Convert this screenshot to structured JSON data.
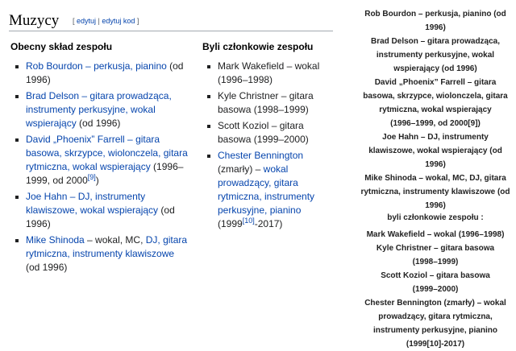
{
  "section": {
    "title": "Muzycy",
    "edit_open": "[ ",
    "edit_label": "edytuj",
    "edit_sep": " | ",
    "edit_code_label": "edytuj kod",
    "edit_close": " ]"
  },
  "current": {
    "heading": "Obecny skład zespołu",
    "members": [
      {
        "name": "Rob Bourdon",
        "sep": " – ",
        "roles": "perkusja, pianino",
        "tail": " (od 1996)"
      },
      {
        "name": "Brad Delson",
        "sep": " – ",
        "roles": "gitara prowadząca, instrumenty perkusyjne, wokal wspierający",
        "tail": " (od 1996)"
      },
      {
        "name": "David „Phoenix” Farrell",
        "sep": " – ",
        "roles": "gitara basowa, skrzypce, wiolonczela, gitara rytmiczna, wokal wspierający",
        "tail": " (1996–1999, od 2000",
        "ref": "[9]",
        "tail2": ")"
      },
      {
        "name": "Joe Hahn",
        "sep": " – ",
        "roles": "DJ, instrumenty klawiszowe, wokal wspierający",
        "tail": " (od 1996)"
      },
      {
        "name": "Mike Shinoda",
        "sep": " – wokal, MC, ",
        "roles": "DJ, gitara rytmiczna, instrumenty klawiszowe",
        "tail": " (od 1996)"
      }
    ]
  },
  "former": {
    "heading": "Byli członkowie zespołu",
    "members": [
      {
        "text": "Mark Wakefield – wokal (1996–1998)"
      },
      {
        "text": "Kyle Christner – gitara basowa (1998–1999)"
      },
      {
        "text": "Scott Koziol – gitara basowa (1999–2000)"
      },
      {
        "name": "Chester Bennington",
        "sep": " (zmarły) – ",
        "roles": "wokal prowadzący, gitara rytmiczna, instrumenty perkusyjne, pianino",
        "tail": " (1999",
        "ref": "[10]",
        "tail2": "-2017)"
      }
    ]
  },
  "aside": {
    "current_lines": [
      "Rob Bourdon – perkusja, pianino (od",
      "1996)",
      "Brad Delson – gitara prowadząca,",
      "instrumenty perkusyjne, wokal",
      "wspierający (od 1996)",
      "David „Phoenix” Farrell – gitara",
      "basowa, skrzypce, wiolonczela, gitara",
      "rytmiczna, wokal wspierający",
      "(1996–1999, od 2000[9])",
      "Joe Hahn – DJ, instrumenty",
      "klawiszowe, wokal wspierający (od",
      "1996)",
      "Mike Shinoda – wokal, MC, DJ, gitara",
      "rytmiczna, instrumenty klawiszowe (od",
      "1996)"
    ],
    "former_heading": "byli członkowie zespołu :",
    "former_lines": [
      "Mark Wakefield – wokal (1996–1998)",
      "Kyle Christner – gitara basowa",
      "(1998–1999)",
      "Scott Koziol – gitara basowa",
      "(1999–2000)",
      "Chester Bennington (zmarły) – wokal",
      "prowadzący, gitara rytmiczna,",
      "instrumenty perkusyjne, pianino",
      "(1999[10]-2017)"
    ]
  }
}
